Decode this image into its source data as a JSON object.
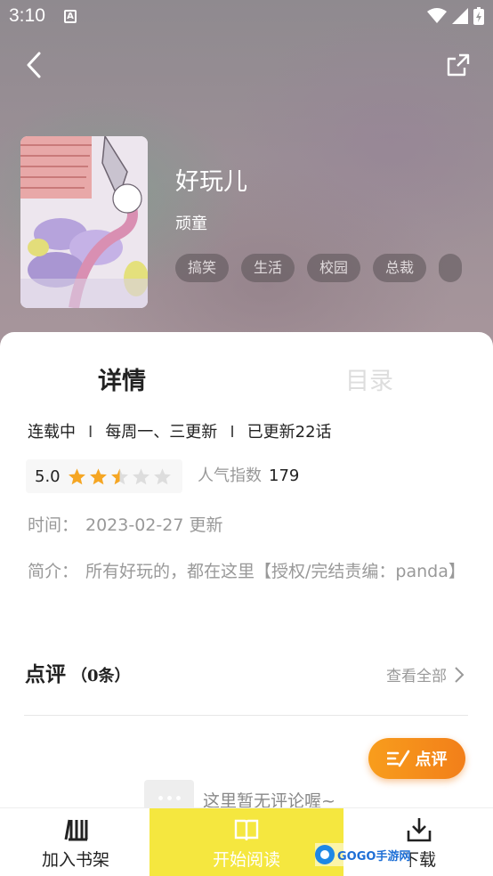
{
  "status_bar": {
    "time": "3:10",
    "a_icon": "A"
  },
  "header": {
    "back_icon": "chevron-left-icon",
    "share_icon": "share-icon"
  },
  "comic": {
    "title": "好玩儿",
    "author": "顽童",
    "tags": [
      "搞笑",
      "生活",
      "校园",
      "总裁"
    ]
  },
  "tabs": {
    "detail": "详情",
    "toc": "目录"
  },
  "meta": {
    "status": "连载中",
    "schedule": "每周一、三更新",
    "episodes": "已更新22话",
    "separator": "I"
  },
  "rating": {
    "score": "5.0",
    "stars_value": 2.5,
    "stars_max": 5,
    "star_color": "#f5a623"
  },
  "popularity": {
    "label": "人气指数",
    "value": "179"
  },
  "time_row": {
    "label": "时间：",
    "value": "2023-02-27 更新"
  },
  "intro_row": {
    "label": "简介：",
    "value": "所有好玩的，都在这里【授权/完结责编：panda】"
  },
  "reviews": {
    "title": "点评",
    "count": "（0条）",
    "see_all": "查看全部",
    "button_label": "点评",
    "empty_text": "这里暂无评论喔~"
  },
  "bottom_bar": {
    "shelf_label": "加入书架",
    "read_label": "开始阅读",
    "download_label": "下载",
    "accent": "#f5e73f"
  },
  "watermark": {
    "text": "GOGO手游网"
  }
}
